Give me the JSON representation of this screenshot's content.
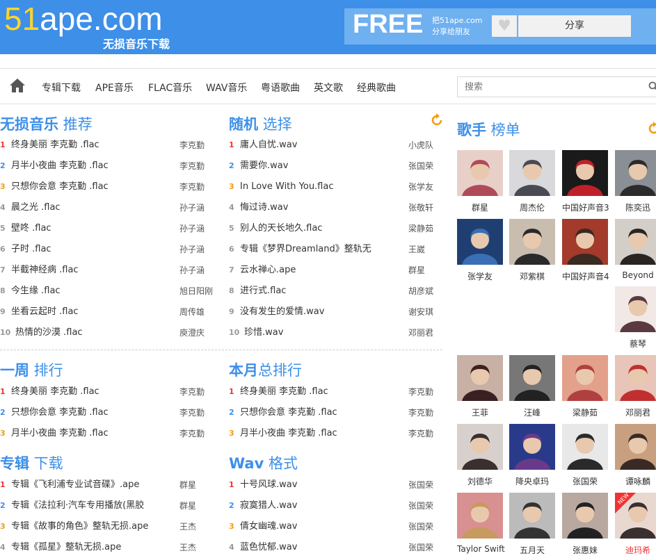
{
  "header": {
    "logo_num": "51",
    "logo_rest": "ape.com",
    "logo_sub": "无损音乐下载",
    "free": "FREE",
    "free_sub1": "把51ape.com",
    "free_sub2": "分享给朋友",
    "heart_icon": "♥",
    "share_label": "分享"
  },
  "nav": {
    "items": [
      "专辑下载",
      "APE音乐",
      "FLAC音乐",
      "WAV音乐",
      "粤语歌曲",
      "英文歌",
      "经典歌曲"
    ],
    "search_placeholder": "搜索"
  },
  "sections": {
    "recommend": {
      "title_bold": "无损音乐",
      "title_rest": " 推荐",
      "rows": [
        {
          "rank": "1",
          "title": "终身美丽 李克勤 .flac",
          "artist": "李克勤"
        },
        {
          "rank": "2",
          "title": "月半小夜曲 李克勤 .flac",
          "artist": "李克勤"
        },
        {
          "rank": "3",
          "title": "只想你会意 李克勤 .flac",
          "artist": "李克勤"
        },
        {
          "rank": "4",
          "title": "晨之光 .flac",
          "artist": "孙子涵"
        },
        {
          "rank": "5",
          "title": "壁咚 .flac",
          "artist": "孙子涵"
        },
        {
          "rank": "6",
          "title": "子时 .flac",
          "artist": "孙子涵"
        },
        {
          "rank": "7",
          "title": "半截神经病 .flac",
          "artist": "孙子涵"
        },
        {
          "rank": "8",
          "title": "今生缘 .flac",
          "artist": "旭日阳刚"
        },
        {
          "rank": "9",
          "title": "坐看云起时 .flac",
          "artist": "周传雄"
        },
        {
          "rank": "10",
          "title": "热情的沙漠 .flac",
          "artist": "庾澄庆"
        }
      ]
    },
    "random": {
      "title_bold": "随机",
      "title_rest": " 选择",
      "rows": [
        {
          "rank": "1",
          "title": "庸人自忧.wav",
          "artist": "小虎队"
        },
        {
          "rank": "2",
          "title": "需要你.wav",
          "artist": "张国荣"
        },
        {
          "rank": "3",
          "title": "In Love With You.flac",
          "artist": "张学友"
        },
        {
          "rank": "4",
          "title": "悔过诗.wav",
          "artist": "张敬轩"
        },
        {
          "rank": "5",
          "title": "别人的天长地久.flac",
          "artist": "梁静茹"
        },
        {
          "rank": "6",
          "title": "专辑《梦界Dreamland》整轨无",
          "artist": "王崴"
        },
        {
          "rank": "7",
          "title": "云水禅心.ape",
          "artist": "群星"
        },
        {
          "rank": "8",
          "title": "进行式.flac",
          "artist": "胡彦斌"
        },
        {
          "rank": "9",
          "title": "没有发生的爱情.wav",
          "artist": "谢安琪"
        },
        {
          "rank": "10",
          "title": "珍惜.wav",
          "artist": "邓丽君"
        }
      ]
    },
    "week": {
      "title_bold": "一周",
      "title_rest": " 排行",
      "rows": [
        {
          "rank": "1",
          "title": "终身美丽 李克勤 .flac",
          "artist": "李克勤"
        },
        {
          "rank": "2",
          "title": "只想你会意 李克勤 .flac",
          "artist": "李克勤"
        },
        {
          "rank": "3",
          "title": "月半小夜曲 李克勤 .flac",
          "artist": "李克勤"
        }
      ]
    },
    "month": {
      "title_bold": "本月",
      "title_rest": "总排行",
      "rows": [
        {
          "rank": "1",
          "title": "终身美丽 李克勤 .flac",
          "artist": "李克勤"
        },
        {
          "rank": "2",
          "title": "只想你会意 李克勤 .flac",
          "artist": "李克勤"
        },
        {
          "rank": "3",
          "title": "月半小夜曲 李克勤 .flac",
          "artist": "李克勤"
        }
      ]
    },
    "albums": {
      "title_bold": "专辑",
      "title_rest": " 下载",
      "rows": [
        {
          "rank": "1",
          "title": "专辑《飞利浦专业试音碟》.ape",
          "artist": "群星"
        },
        {
          "rank": "2",
          "title": "专辑《法拉利·汽车专用播放(黑胶",
          "artist": "群星"
        },
        {
          "rank": "3",
          "title": "专辑《故事的角色》整轨无损.ape",
          "artist": "王杰"
        },
        {
          "rank": "4",
          "title": "专辑《孤星》整轨无损.ape",
          "artist": "王杰"
        }
      ]
    },
    "wav": {
      "title_bold": "Wav",
      "title_rest": " 格式",
      "rows": [
        {
          "rank": "1",
          "title": "十号风球.wav",
          "artist": "张国荣"
        },
        {
          "rank": "2",
          "title": "寂寞猎人.wav",
          "artist": "张国荣"
        },
        {
          "rank": "3",
          "title": "倩女幽魂.wav",
          "artist": "张国荣"
        },
        {
          "rank": "4",
          "title": "蓝色忧郁.wav",
          "artist": "张国荣"
        }
      ]
    },
    "singers": {
      "title_bold": "歌手",
      "title_rest": " 榜单",
      "items": [
        {
          "name": "群星",
          "color": "#b04a5a",
          "bg": "#e8d0c8"
        },
        {
          "name": "周杰伦",
          "color": "#4a4a55",
          "bg": "#d9d9dc"
        },
        {
          "name": "中国好声音3",
          "color": "#c0202a",
          "bg": "#1a1a1a"
        },
        {
          "name": "陈奕迅",
          "color": "#2b2b2b",
          "bg": "#8a8f96"
        },
        {
          "name": "张学友",
          "color": "#3a6fb5",
          "bg": "#1f3f73"
        },
        {
          "name": "邓紫棋",
          "color": "#2a2a2a",
          "bg": "#c9bdb0"
        },
        {
          "name": "中国好声音4",
          "color": "#3a2a20",
          "bg": "#a33a2c"
        },
        {
          "name": "Beyond",
          "color": "#2a2520",
          "bg": "#d3cfc8"
        },
        {
          "name": "蔡琴",
          "color": "#5a3a40",
          "bg": "#f2e8e6"
        },
        {
          "name": "王菲",
          "color": "#3a2020",
          "bg": "#c8b0a5"
        },
        {
          "name": "汪峰",
          "color": "#222",
          "bg": "#777"
        },
        {
          "name": "梁静茹",
          "color": "#b04040",
          "bg": "#e3a08a"
        },
        {
          "name": "邓丽君",
          "color": "#c03030",
          "bg": "#e8c5b8"
        },
        {
          "name": "刘德华",
          "color": "#3a3030",
          "bg": "#d8d0cc"
        },
        {
          "name": "降央卓玛",
          "color": "#6a3a8a",
          "bg": "#2a3a8a"
        },
        {
          "name": "张国荣",
          "color": "#2a2a2a",
          "bg": "#e8e8e8"
        },
        {
          "name": "谭咏麟",
          "color": "#3a2a25",
          "bg": "#c8a080"
        },
        {
          "name": "Taylor Swift",
          "color": "#c89a60",
          "bg": "#d89090"
        },
        {
          "name": "五月天",
          "color": "#333",
          "bg": "#bbb"
        },
        {
          "name": "张惠妹",
          "color": "#222",
          "bg": "#b8a8a0"
        },
        {
          "name": "迪玛希",
          "color": "#3a3030",
          "bg": "#e8d8d0"
        }
      ],
      "new_badge": "NEW"
    }
  }
}
